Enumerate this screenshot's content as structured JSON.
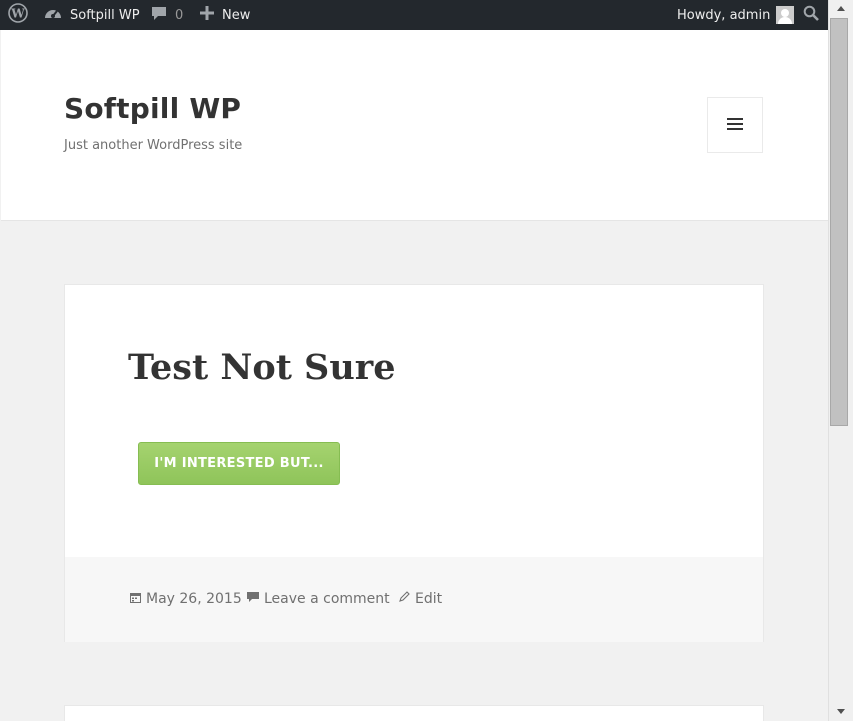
{
  "adminbar": {
    "site_name": "Softpill WP",
    "comment_count": "0",
    "new_label": "New",
    "howdy": "Howdy, admin"
  },
  "header": {
    "site_title": "Softpill WP",
    "site_description": "Just another WordPress site"
  },
  "post": {
    "title": "Test Not Sure",
    "button_label": "I'M INTERESTED BUT...",
    "date": "May 26, 2015",
    "comment_link": "Leave a comment",
    "edit_link": "Edit"
  },
  "colors": {
    "adminbar_bg": "#23282d",
    "button_green": "#9acb65",
    "page_bg": "#f1f1f1"
  },
  "icons": [
    "wordpress-icon",
    "dashboard-icon",
    "comment-icon",
    "plus-icon",
    "avatar",
    "search-icon",
    "menu-icon",
    "calendar-icon",
    "edit-icon"
  ]
}
